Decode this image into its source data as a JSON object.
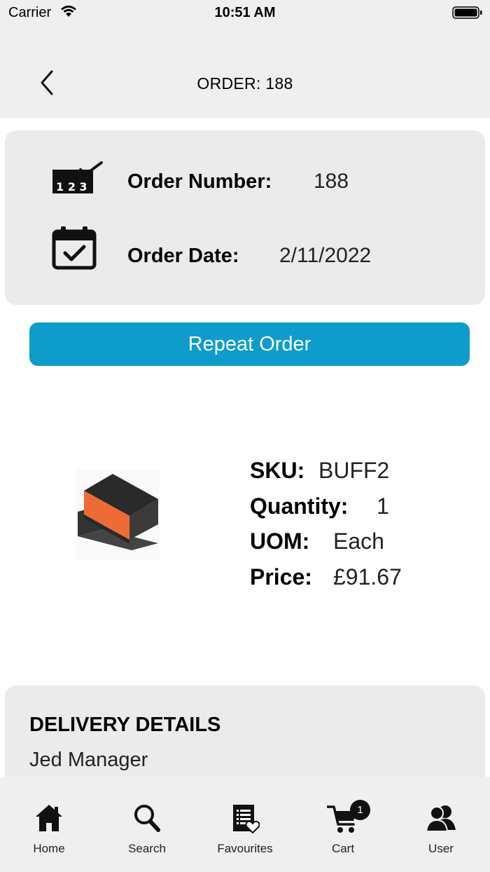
{
  "status_bar": {
    "carrier": "Carrier",
    "time": "10:51 AM"
  },
  "nav": {
    "title": "ORDER: 188"
  },
  "summary": {
    "order_number_label": "Order Number:",
    "order_number_value": "188",
    "order_date_label": "Order Date:",
    "order_date_value": "2/11/2022",
    "icon_number": "123-check-icon",
    "icon_date": "calendar-check-icon"
  },
  "repeat_button": {
    "label": "Repeat Order",
    "color": "#0e9ccd"
  },
  "product": {
    "sku_label": "SKU:",
    "sku_value": "BUFF2",
    "quantity_label": "Quantity:",
    "quantity_value": "1",
    "uom_label": "UOM:",
    "uom_value": "Each",
    "price_label": "Price:",
    "price_value": "£91.67"
  },
  "delivery": {
    "title": "DELIVERY DETAILS",
    "name": "Jed Manager"
  },
  "tabs": [
    {
      "label": "Home",
      "icon": "home-icon"
    },
    {
      "label": "Search",
      "icon": "search-icon"
    },
    {
      "label": "Favourites",
      "icon": "favourites-list-icon"
    },
    {
      "label": "Cart",
      "icon": "cart-icon",
      "badge": "1"
    },
    {
      "label": "User",
      "icon": "users-icon"
    }
  ]
}
